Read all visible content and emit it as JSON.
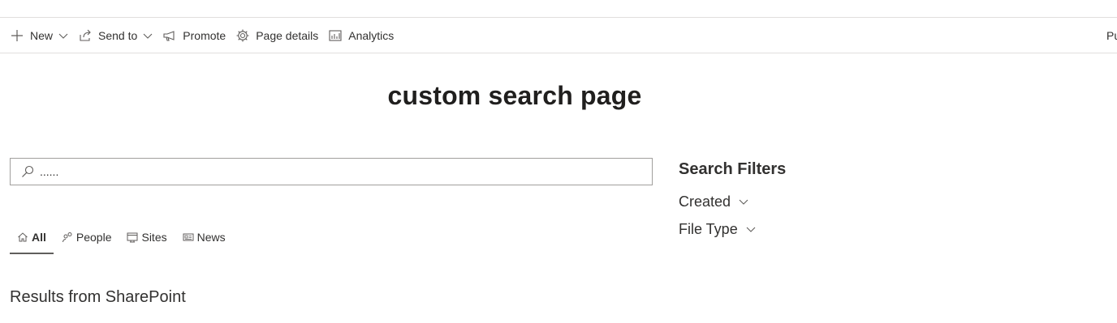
{
  "commandbar": {
    "items": [
      {
        "label": "New",
        "icon": "plus-icon",
        "has_dropdown": true
      },
      {
        "label": "Send to",
        "icon": "share-icon",
        "has_dropdown": true
      },
      {
        "label": "Promote",
        "icon": "megaphone-icon",
        "has_dropdown": false
      },
      {
        "label": "Page details",
        "icon": "gear-icon",
        "has_dropdown": false
      },
      {
        "label": "Analytics",
        "icon": "analytics-chart-icon",
        "has_dropdown": false
      }
    ],
    "right_cut_label": "Pu"
  },
  "page": {
    "title": "custom search page"
  },
  "search": {
    "value": "......",
    "placeholder": "",
    "icon": "search-icon"
  },
  "tabs": [
    {
      "label": "All",
      "icon": "home-icon",
      "active": true
    },
    {
      "label": "People",
      "icon": "people-icon",
      "active": false
    },
    {
      "label": "Sites",
      "icon": "sites-icon",
      "active": false
    },
    {
      "label": "News",
      "icon": "news-icon",
      "active": false
    }
  ],
  "results": {
    "heading": "Results from SharePoint"
  },
  "filters": {
    "title": "Search Filters",
    "items": [
      {
        "label": "Created"
      },
      {
        "label": "File Type"
      }
    ]
  }
}
